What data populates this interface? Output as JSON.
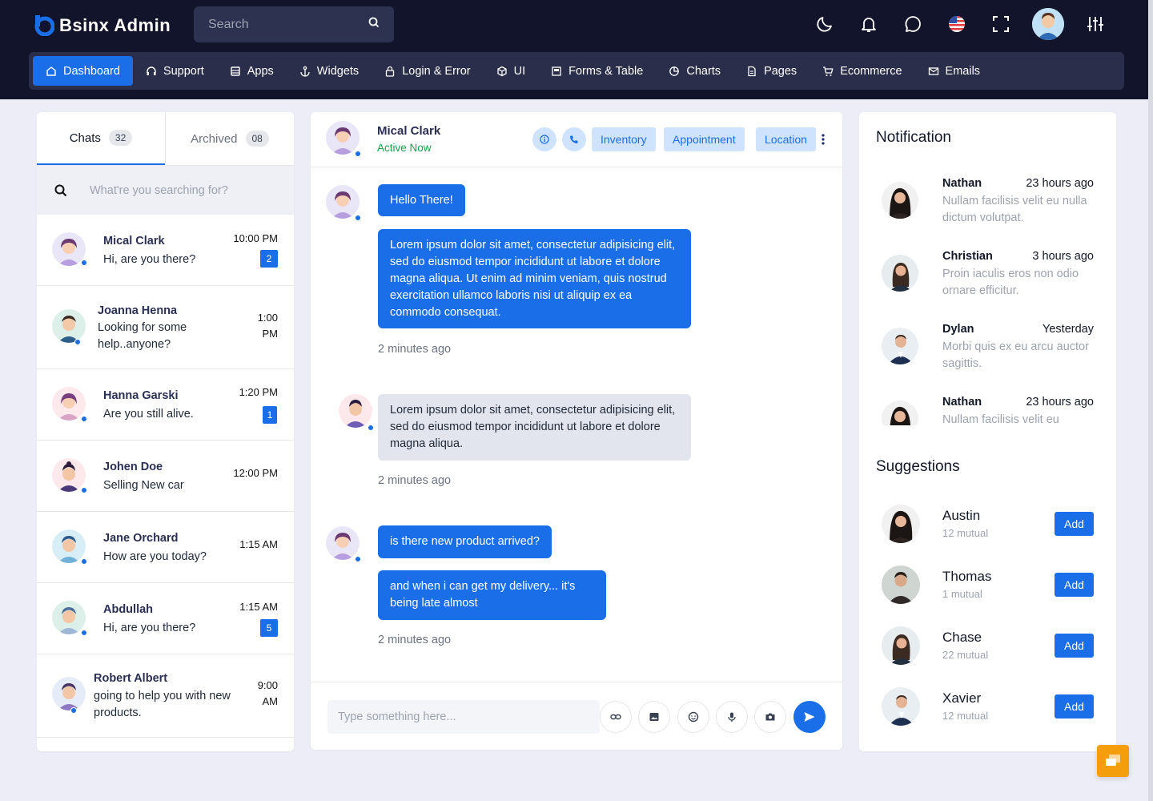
{
  "brand": {
    "name": "Bsinx Admin"
  },
  "header": {
    "search_placeholder": "Search"
  },
  "nav": [
    {
      "label": "Dashboard",
      "icon": "home-icon",
      "active": true
    },
    {
      "label": "Support",
      "icon": "headset-icon"
    },
    {
      "label": "Apps",
      "icon": "database-icon"
    },
    {
      "label": "Widgets",
      "icon": "anchor-icon"
    },
    {
      "label": "Login & Error",
      "icon": "lock-icon"
    },
    {
      "label": "UI",
      "icon": "box-icon"
    },
    {
      "label": "Forms & Table",
      "icon": "table-icon"
    },
    {
      "label": "Charts",
      "icon": "pie-chart-icon"
    },
    {
      "label": "Pages",
      "icon": "file-icon"
    },
    {
      "label": "Ecommerce",
      "icon": "cart-icon"
    },
    {
      "label": "Emails",
      "icon": "mail-icon"
    }
  ],
  "chats_panel": {
    "tabs": [
      {
        "label": "Chats",
        "count": "32"
      },
      {
        "label": "Archived",
        "count": "08"
      }
    ],
    "search_placeholder": "What're you searching for?",
    "items": [
      {
        "name": "Mical Clark",
        "message": "Hi, are you there?",
        "time": "10:00 PM",
        "badge": "2"
      },
      {
        "name": "Joanna Henna",
        "message": "Looking for some help..anyone?",
        "time": "1:00 PM",
        "badge": ""
      },
      {
        "name": "Hanna Garski",
        "message": "Are you still alive.",
        "time": "1:20 PM",
        "badge": "1"
      },
      {
        "name": "Johen Doe",
        "message": "Selling New car",
        "time": "12:00 PM",
        "badge": ""
      },
      {
        "name": "Jane Orchard",
        "message": "How are you today?",
        "time": "1:15 AM",
        "badge": ""
      },
      {
        "name": "Abdullah",
        "message": "Hi, are you there?",
        "time": "1:15 AM",
        "badge": "5"
      },
      {
        "name": "Robert Albert",
        "message": "going to help you with new products.",
        "time": "9:00 AM",
        "badge": ""
      }
    ]
  },
  "conversation": {
    "contact_name": "Mical Clark",
    "status": "Active Now",
    "actions": [
      "Inventory",
      "Appointment",
      "Location"
    ],
    "messages": [
      {
        "text": "Hello There!"
      },
      {
        "text": "Lorem ipsum dolor sit amet, consectetur adipisicing elit, sed do eiusmod tempor incididunt ut labore et dolore magna aliqua. Ut enim ad minim veniam, quis nostrud exercitation ullamco laboris nisi ut aliquip ex ea commodo consequat."
      },
      {
        "text": "Lorem ipsum dolor sit amet, consectetur adipisicing elit, sed do eiusmod tempor incididunt ut labore et dolore magna aliqua."
      },
      {
        "text": "is there new product arrived?"
      },
      {
        "text": "and when i can get my delivery... it's being late almost"
      }
    ],
    "timestamps": [
      "2 minutes ago",
      "2 minutes ago",
      "2 minutes ago"
    ],
    "composer_placeholder": "Type something here..."
  },
  "notifications": {
    "title": "Notification",
    "items": [
      {
        "name": "Nathan",
        "time": "23 hours ago",
        "text": "Nullam facilisis velit eu nulla dictum volutpat."
      },
      {
        "name": "Christian",
        "time": "3 hours ago",
        "text": "Proin iaculis eros non odio ornare efficitur."
      },
      {
        "name": "Dylan",
        "time": "Yesterday",
        "text": "Morbi quis ex eu arcu auctor sagittis."
      },
      {
        "name": "Nathan",
        "time": "23 hours ago",
        "text": "Nullam facilisis velit eu"
      }
    ]
  },
  "suggestions": {
    "title": "Suggestions",
    "add_label": "Add",
    "items": [
      {
        "name": "Austin",
        "mutual": "12 mutual"
      },
      {
        "name": "Thomas",
        "mutual": "1 mutual"
      },
      {
        "name": "Chase",
        "mutual": "22 mutual"
      },
      {
        "name": "Xavier",
        "mutual": "12 mutual"
      }
    ]
  },
  "colors": {
    "primary": "#1a6fe9",
    "topbar": "#11142a",
    "navbar": "#2a2e4a",
    "fab": "#f59e0b"
  }
}
